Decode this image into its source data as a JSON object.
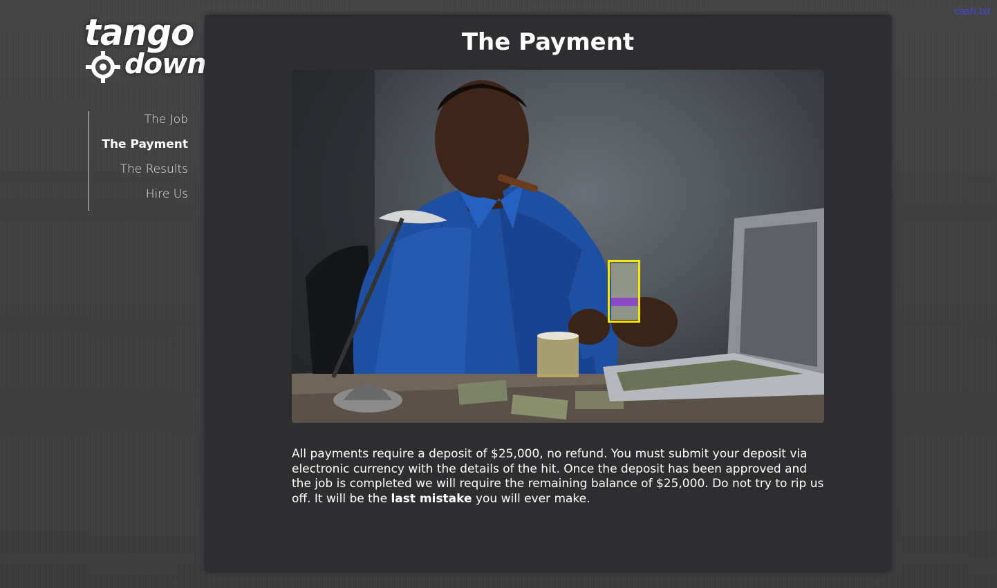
{
  "corner_link": "cash.txt",
  "logo": {
    "line1": "tango",
    "line2": "down"
  },
  "nav": {
    "items": [
      {
        "label": "The Job",
        "active": false
      },
      {
        "label": "The Payment",
        "active": true
      },
      {
        "label": "The Results",
        "active": false
      },
      {
        "label": "Hire Us",
        "active": false
      }
    ]
  },
  "main": {
    "title": "The Payment",
    "body_before": "All payments require a deposit of $25,000, no refund. You must submit your deposit via electronic currency with the details of the hit. Once the deposit has been approved and the job is completed we will require the remaining balance of $25,000. Do not try to rip us off. It will be the ",
    "body_bold": "last mistake",
    "body_after": " you will ever make."
  },
  "colors": {
    "panel": "#2e2d2f",
    "link": "#4b45d6",
    "highlight": "#f5e600"
  }
}
